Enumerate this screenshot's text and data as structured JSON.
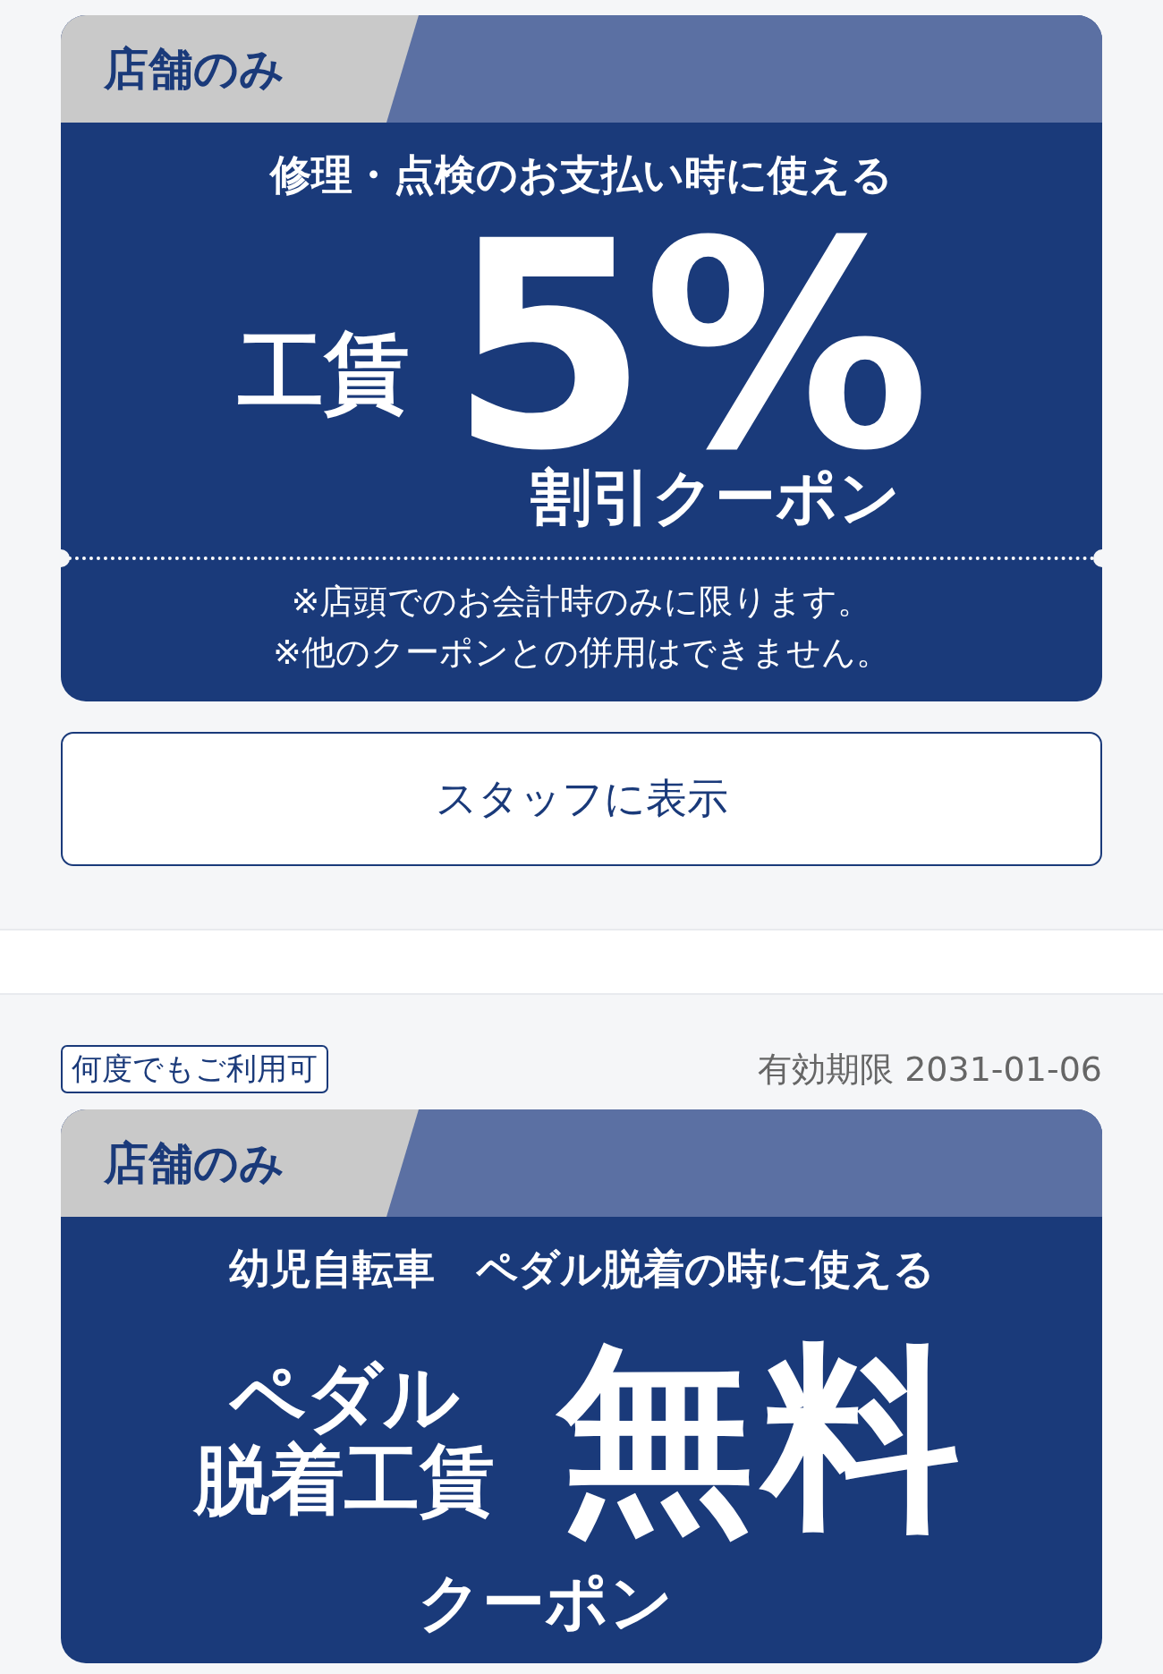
{
  "coupons": [
    {
      "kind": "percent",
      "badge": "店舗のみ",
      "headline": "修理・点検のお支払い時に使える",
      "main_label": [
        "工賃"
      ],
      "main_value": "5%",
      "suffix": "割引クーポン",
      "notes": [
        "※店頭でのお会計時のみに限ります。",
        "※他のクーポンとの併用はできません。"
      ],
      "button": "スタッフに表示"
    },
    {
      "kind": "free",
      "tag": "何度でもご利用可",
      "expiry": "有効期限 2031-01-06",
      "badge": "店舗のみ",
      "headline": "幼児自転車　ペダル脱着の時に使える",
      "main_label": [
        "ペダル",
        "脱着工賃"
      ],
      "main_value": "無料",
      "suffix": "クーポン"
    }
  ]
}
